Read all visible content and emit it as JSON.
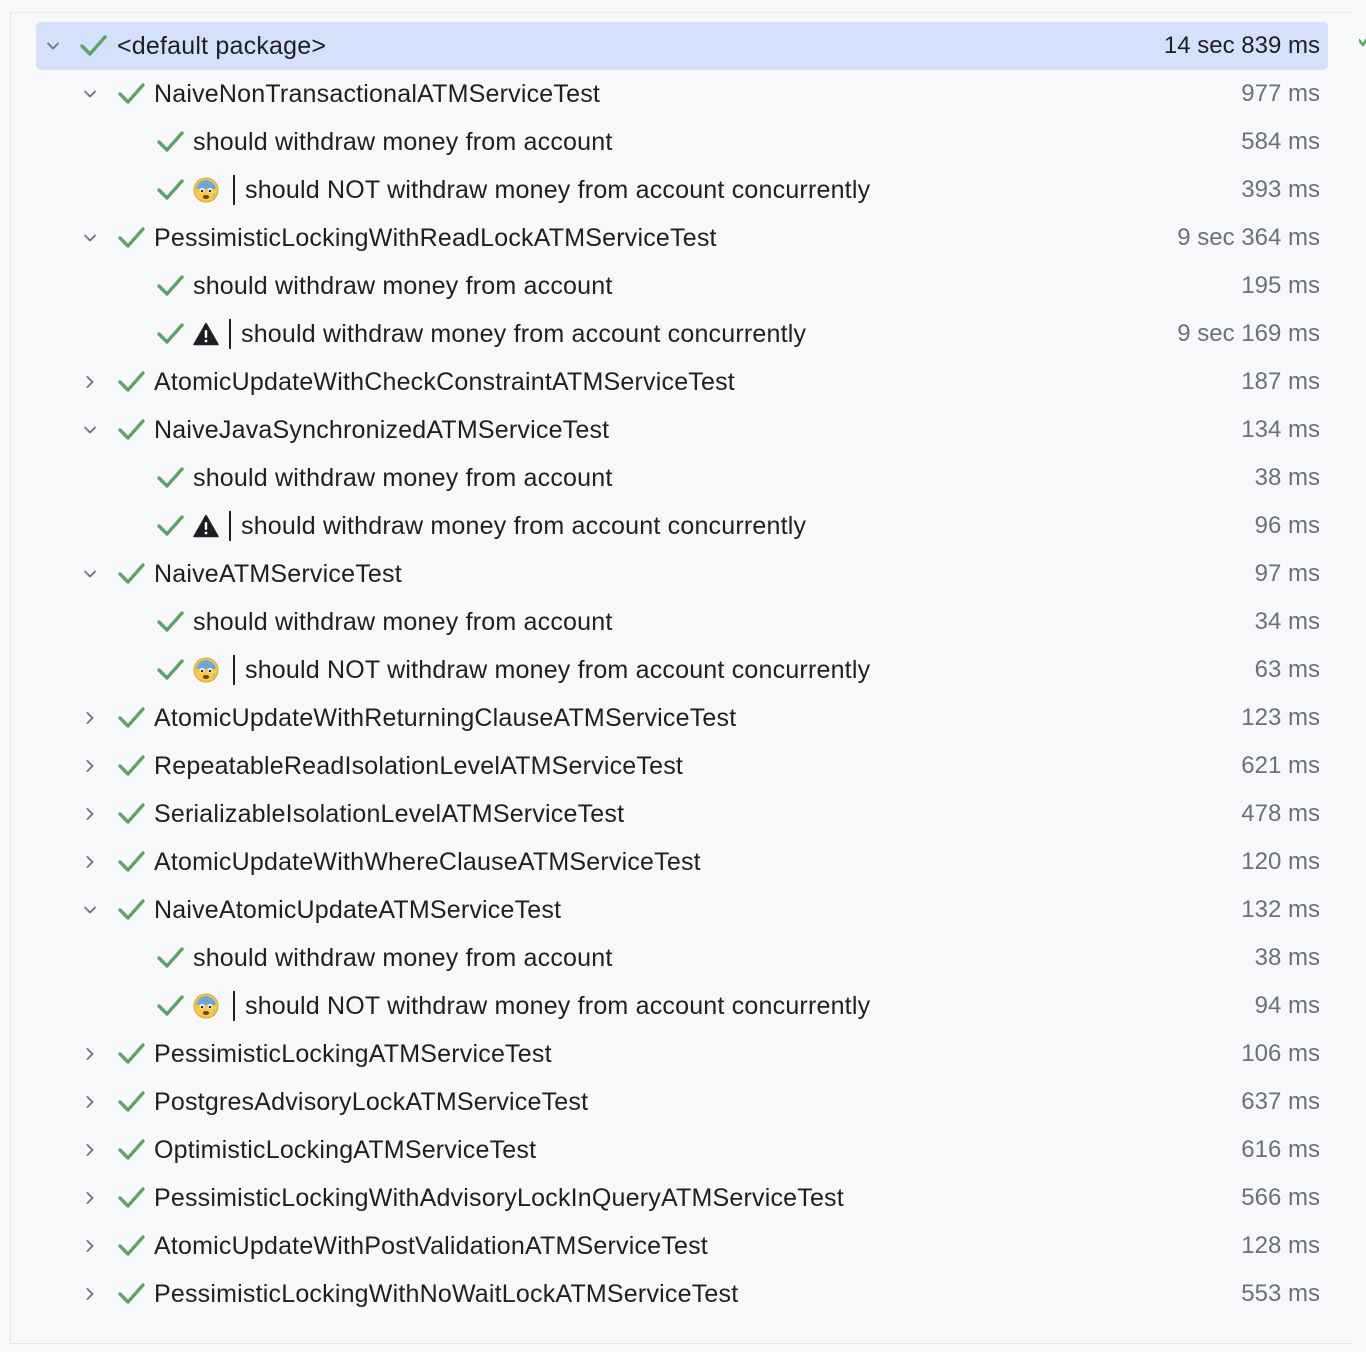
{
  "root": {
    "label": "<default package>",
    "duration": "14 sec 839 ms",
    "status": "passed",
    "expanded": true
  },
  "classes": [
    {
      "name": "NaiveNonTransactionalATMServiceTest",
      "duration": "977 ms",
      "expanded": true,
      "tests": [
        {
          "icon": "none",
          "label": "should withdraw money from account",
          "duration": "584 ms"
        },
        {
          "icon": "scared-face-emoji",
          "label": "should NOT withdraw money from account concurrently",
          "duration": "393 ms"
        }
      ]
    },
    {
      "name": "PessimisticLockingWithReadLockATMServiceTest",
      "duration": "9 sec 364 ms",
      "expanded": true,
      "tests": [
        {
          "icon": "none",
          "label": "should withdraw money from account",
          "duration": "195 ms"
        },
        {
          "icon": "warning-icon",
          "label": "should withdraw money from account concurrently",
          "duration": "9 sec 169 ms"
        }
      ]
    },
    {
      "name": "AtomicUpdateWithCheckConstraintATMServiceTest",
      "duration": "187 ms",
      "expanded": false,
      "tests": []
    },
    {
      "name": "NaiveJavaSynchronizedATMServiceTest",
      "duration": "134 ms",
      "expanded": true,
      "tests": [
        {
          "icon": "none",
          "label": "should withdraw money from account",
          "duration": "38 ms"
        },
        {
          "icon": "warning-icon",
          "label": "should withdraw money from account concurrently",
          "duration": "96 ms"
        }
      ]
    },
    {
      "name": "NaiveATMServiceTest",
      "duration": "97 ms",
      "expanded": true,
      "tests": [
        {
          "icon": "none",
          "label": "should withdraw money from account",
          "duration": "34 ms"
        },
        {
          "icon": "scared-face-emoji",
          "label": "should NOT withdraw money from account concurrently",
          "duration": "63 ms"
        }
      ]
    },
    {
      "name": "AtomicUpdateWithReturningClauseATMServiceTest",
      "duration": "123 ms",
      "expanded": false,
      "tests": []
    },
    {
      "name": "RepeatableReadIsolationLevelATMServiceTest",
      "duration": "621 ms",
      "expanded": false,
      "tests": []
    },
    {
      "name": "SerializableIsolationLevelATMServiceTest",
      "duration": "478 ms",
      "expanded": false,
      "tests": []
    },
    {
      "name": "AtomicUpdateWithWhereClauseATMServiceTest",
      "duration": "120 ms",
      "expanded": false,
      "tests": []
    },
    {
      "name": "NaiveAtomicUpdateATMServiceTest",
      "duration": "132 ms",
      "expanded": true,
      "tests": [
        {
          "icon": "none",
          "label": "should withdraw money from account",
          "duration": "38 ms"
        },
        {
          "icon": "scared-face-emoji",
          "label": "should NOT withdraw money from account concurrently",
          "duration": "94 ms"
        }
      ]
    },
    {
      "name": "PessimisticLockingATMServiceTest",
      "duration": "106 ms",
      "expanded": false,
      "tests": []
    },
    {
      "name": "PostgresAdvisoryLockATMServiceTest",
      "duration": "637 ms",
      "expanded": false,
      "tests": []
    },
    {
      "name": "OptimisticLockingATMServiceTest",
      "duration": "616 ms",
      "expanded": false,
      "tests": []
    },
    {
      "name": "PessimisticLockingWithAdvisoryLockInQueryATMServiceTest",
      "duration": "566 ms",
      "expanded": false,
      "tests": []
    },
    {
      "name": "AtomicUpdateWithPostValidationATMServiceTest",
      "duration": "128 ms",
      "expanded": false,
      "tests": []
    },
    {
      "name": "PessimisticLockingWithNoWaitLockATMServiceTest",
      "duration": "553 ms",
      "expanded": false,
      "tests": []
    }
  ],
  "colors": {
    "pass_check": "#5fa36b",
    "selection": "#d5e1fa",
    "duration_text": "#6c707e",
    "text": "#1e1f22",
    "chevron": "#6c707e"
  }
}
